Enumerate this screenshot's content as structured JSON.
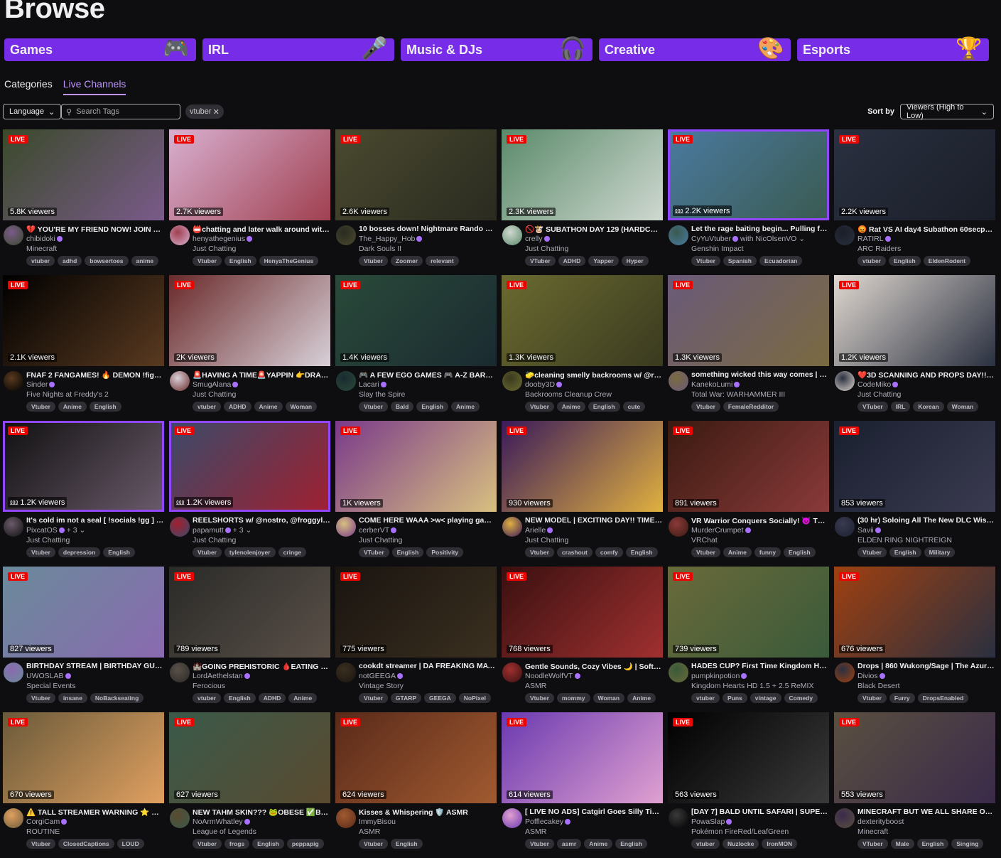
{
  "header": {
    "title": "Browse"
  },
  "categories": [
    {
      "label": "Games",
      "icon": "gamepad-icon",
      "glyph": "🎮"
    },
    {
      "label": "IRL",
      "icon": "microphone-icon",
      "glyph": "🎤"
    },
    {
      "label": "Music & DJs",
      "icon": "headphones-icon",
      "glyph": "🎧"
    },
    {
      "label": "Creative",
      "icon": "palette-icon",
      "glyph": "🎨"
    },
    {
      "label": "Esports",
      "icon": "trophy-icon",
      "glyph": "🏆"
    }
  ],
  "tabs": [
    {
      "label": "Categories"
    },
    {
      "label": "Live Channels",
      "active": true
    }
  ],
  "filters": {
    "language": "Language",
    "search_placeholder": "Search Tags",
    "active_tag": "vtuber",
    "sort_label": "Sort by",
    "sort_value": "Viewers (High to Low)"
  },
  "live_label": "LIVE",
  "colors": {
    "accent": "#772ce8",
    "live": "#eb0400",
    "link": "#bf94ff"
  },
  "streams": [
    {
      "title": "💔 YOU'RE MY FRIEND NOW! JOIN US! ...",
      "channel": "chibidoki",
      "category": "Minecraft",
      "tags": [
        "vtuber",
        "adhd",
        "bowsertoes",
        "anime"
      ],
      "viewers": "5.8K viewers",
      "c": [
        "#3a4a2a",
        "#7a5a8a"
      ]
    },
    {
      "title": "📛chatting and later walk around with ...",
      "channel": "henyathegenius",
      "category": "Just Chatting",
      "tags": [
        "Vtuber",
        "English",
        "HenyaTheGenius"
      ],
      "viewers": "2.7K viewers",
      "c": [
        "#d8b0d0",
        "#a04050"
      ]
    },
    {
      "title": "10 bosses down! Nightmare Rando No ...",
      "channel": "The_Happy_Hob",
      "category": "Dark Souls II",
      "tags": [
        "Vtuber",
        "Zoomer",
        "relevant"
      ],
      "viewers": "2.6K viewers",
      "c": [
        "#4a4a30",
        "#2a2a20"
      ]
    },
    {
      "title": "🚫🐮 SUBATHON DAY 129 (HARDCOR...",
      "channel": "crelly",
      "category": "Just Chatting",
      "tags": [
        "VTuber",
        "ADHD",
        "Yapper",
        "Hyper"
      ],
      "viewers": "2.3K viewers",
      "c": [
        "#5a8a6a",
        "#cfd8d0"
      ]
    },
    {
      "title": "Let the rage baiting begin... Pulling for ...",
      "channel": "CyYuVtuber",
      "extra": "with NicOlsenVO ⌄",
      "category": "Genshin Impact",
      "tags": [
        "Vtuber",
        "Spanish",
        "Ecuadorian"
      ],
      "viewers": "2.2K viewers",
      "squad": true,
      "hl": true,
      "c": [
        "#4a7aa0",
        "#3a5a50"
      ]
    },
    {
      "title": "😡 Rat VS AI day4 Subathon 60secper...",
      "channel": "RATIRL",
      "category": "ARC Raiders",
      "tags": [
        "vtuber",
        "English",
        "EldenRodent"
      ],
      "viewers": "2.2K viewers",
      "c": [
        "#2a3040",
        "#1a1e28"
      ]
    },
    {
      "title": "FNAF 2 FANGAMES! 🔥 DEMON !figure ...",
      "channel": "Sinder",
      "category": "Five Nights at Freddy's 2",
      "tags": [
        "Vtuber",
        "Anime",
        "English"
      ],
      "viewers": "2.1K viewers",
      "c": [
        "#000000",
        "#5a3a20"
      ]
    },
    {
      "title": "🚨HAVING A TIME🚨YAPPIN 👉DRAM...",
      "channel": "SmugAlana",
      "category": "Just Chatting",
      "tags": [
        "vtuber",
        "ADHD",
        "Anime",
        "Woman"
      ],
      "viewers": "2K viewers",
      "c": [
        "#6a2a2a",
        "#d8d0d8"
      ]
    },
    {
      "title": "🎮 A FEW EGO GAMES 🎮 A-Z BARD S...",
      "channel": "Lacari",
      "category": "Slay the Spire",
      "tags": [
        "Vtuber",
        "Bald",
        "English",
        "Anime"
      ],
      "viewers": "1.4K viewers",
      "c": [
        "#2a4a3a",
        "#1a2a30"
      ]
    },
    {
      "title": "🧽cleaning smelly backrooms w/ @re...",
      "channel": "dooby3D",
      "category": "Backrooms Cleanup Crew",
      "tags": [
        "Vtuber",
        "Anime",
        "English",
        "cute"
      ],
      "viewers": "1.3K viewers",
      "c": [
        "#6a6a30",
        "#3a3a20"
      ]
    },
    {
      "title": "something wicked this way comes | #s...",
      "channel": "KanekoLumi",
      "category": "Total War: WARHAMMER III",
      "tags": [
        "Vtuber",
        "FemaleRedditor"
      ],
      "viewers": "1.3K viewers",
      "c": [
        "#6a5a7a",
        "#7a6a40"
      ]
    },
    {
      "title": "❤️3D SCANNING AND PROPS DAY!! W...",
      "channel": "CodeMiko",
      "category": "Just Chatting",
      "tags": [
        "VTuber",
        "IRL",
        "Korean",
        "Woman"
      ],
      "viewers": "1.2K viewers",
      "c": [
        "#e0d8d0",
        "#2a3040"
      ]
    },
    {
      "title": "It's cold im not a seal [ !socials !gg ] #C...",
      "channel": "PixcatOS",
      "extra": "+ 3 ⌄",
      "category": "Just Chatting",
      "tags": [
        "Vtuber",
        "depression",
        "English"
      ],
      "viewers": "1.2K viewers",
      "squad": true,
      "hl": true,
      "c": [
        "#101010",
        "#6a5a6a"
      ]
    },
    {
      "title": "REELSHORTS w/ @nostro, @froggyloc...",
      "channel": "papamutt",
      "extra": "+ 3 ⌄",
      "category": "Just Chatting",
      "tags": [
        "Vtuber",
        "tylenolenjoyer",
        "cringe"
      ],
      "viewers": "1.2K viewers",
      "squad": true,
      "hl": true,
      "c": [
        "#3a4a6a",
        "#a02030"
      ]
    },
    {
      "title": "COME HERE WAAA >w< playing games...",
      "channel": "cerberVT",
      "category": "Just Chatting",
      "tags": [
        "VTuber",
        "English",
        "Positivity"
      ],
      "viewers": "1K viewers",
      "c": [
        "#7a3a8a",
        "#d8c080"
      ]
    },
    {
      "title": "NEW MODEL | EXCITING DAY!! TIME T...",
      "channel": "Arielle",
      "category": "Just Chatting",
      "tags": [
        "Vtuber",
        "crashout",
        "comfy",
        "English"
      ],
      "viewers": "930 viewers",
      "c": [
        "#3a1a5a",
        "#e0b040"
      ]
    },
    {
      "title": "VR Warrior Conquers Socially! 😈 Then...",
      "channel": "MurderCrumpet",
      "category": "VRChat",
      "tags": [
        "Vtuber",
        "Anime",
        "funny",
        "English"
      ],
      "viewers": "891 viewers",
      "c": [
        "#3a1a10",
        "#8a3a3a"
      ]
    },
    {
      "title": "(30 hr) Soloing All The New DLC Wish ...",
      "channel": "Savii",
      "category": "ELDEN RING NIGHTREIGN",
      "tags": [
        "Vtuber",
        "English",
        "Military"
      ],
      "viewers": "853 viewers",
      "c": [
        "#1a2030",
        "#3a3a50"
      ]
    },
    {
      "title": "BIRTHDAY STREAM | BIRTHDAY GUY F...",
      "channel": "UWOSLAB",
      "category": "Special Events",
      "tags": [
        "Vtuber",
        "insane",
        "NoBackseating"
      ],
      "viewers": "827 viewers",
      "c": [
        "#6a8a9a",
        "#8a6ab0"
      ]
    },
    {
      "title": "🏰GOING PREHISTORIC 🩸EATING DIN...",
      "channel": "LordAethelstan",
      "category": "Ferocious",
      "tags": [
        "vtuber",
        "English",
        "ADHD",
        "Anime"
      ],
      "viewers": "789 viewers",
      "c": [
        "#2a2a28",
        "#5a5048"
      ]
    },
    {
      "title": "cookdt streamer | DA FREAKING MAYO...",
      "channel": "notGEEGA",
      "category": "Vintage Story",
      "tags": [
        "Vtuber",
        "GTARP",
        "GEEGA",
        "NoPixel"
      ],
      "viewers": "775 viewers",
      "c": [
        "#1a1410",
        "#3a3020"
      ]
    },
    {
      "title": "Gentle Sounds, Cozy Vibes 🌙 | Soft S...",
      "channel": "NoodleWolfVT",
      "category": "ASMR",
      "tags": [
        "Vtuber",
        "mommy",
        "Woman",
        "Anime"
      ],
      "viewers": "768 viewers",
      "c": [
        "#3a1010",
        "#a03030"
      ]
    },
    {
      "title": "HADES CUP? First Time Kingdom Hear...",
      "channel": "pumpkinpotion",
      "category": "Kingdom Hearts HD 1.5 + 2.5 ReMIX",
      "tags": [
        "vtuber",
        "Puns",
        "vintage",
        "Comedy"
      ],
      "viewers": "739 viewers",
      "c": [
        "#6a6a3a",
        "#3a5a3a"
      ]
    },
    {
      "title": "Drops | 860 Wukong/Sage | The Azure ...",
      "channel": "Divios",
      "category": "Black Desert",
      "tags": [
        "Vtuber",
        "Furry",
        "DropsEnabled"
      ],
      "viewers": "676 viewers",
      "c": [
        "#a04010",
        "#2a3040"
      ]
    },
    {
      "title": "⚠️ TALL STREAMER WARNING ⭐ DAY...",
      "channel": "CorgiCam",
      "category": "ROUTINE",
      "tags": [
        "Vtuber",
        "ClosedCaptions",
        "LOUD"
      ],
      "viewers": "670 viewers",
      "c": [
        "#6a5a3a",
        "#e0a060"
      ]
    },
    {
      "title": "NEW TAHM SKIN??? 🐸OBESE ✅BRAIN...",
      "channel": "NoArmWhatley",
      "category": "League of Legends",
      "tags": [
        "Vtuber",
        "frogs",
        "English",
        "peppapig"
      ],
      "viewers": "627 viewers",
      "c": [
        "#3a5a4a",
        "#5a4a30"
      ]
    },
    {
      "title": "Kisses & Whispering 🛡️ ASMR",
      "channel": "ImmyBisou",
      "unverified": true,
      "category": "ASMR",
      "tags": [
        "Vtuber",
        "English"
      ],
      "viewers": "624 viewers",
      "c": [
        "#5a2a1a",
        "#a05a30"
      ]
    },
    {
      "title": "[ LIVE NO ADS] Catgirl Goes Silly Tingl...",
      "channel": "Pofflecakey",
      "category": "ASMR",
      "tags": [
        "Vtuber",
        "asmr",
        "Anime",
        "English"
      ],
      "viewers": "614 viewers",
      "c": [
        "#6a3ab0",
        "#e0a0d0"
      ]
    },
    {
      "title": "[DAY 7] BALD UNTIL SAFARI | SUPER K...",
      "channel": "PowaSlap",
      "category": "Pokémon FireRed/LeafGreen",
      "tags": [
        "vtuber",
        "Nuzlocke",
        "IronMON"
      ],
      "viewers": "563 viewers",
      "c": [
        "#000000",
        "#3a3a3a"
      ]
    },
    {
      "title": "MINECRAFT BUT WE ALL SHARE ONE I...",
      "channel": "dexterityboost",
      "unverified": true,
      "category": "Minecraft",
      "tags": [
        "VTuber",
        "Male",
        "English",
        "Singing"
      ],
      "viewers": "553 viewers",
      "c": [
        "#5a5040",
        "#3a2a4a"
      ]
    }
  ]
}
